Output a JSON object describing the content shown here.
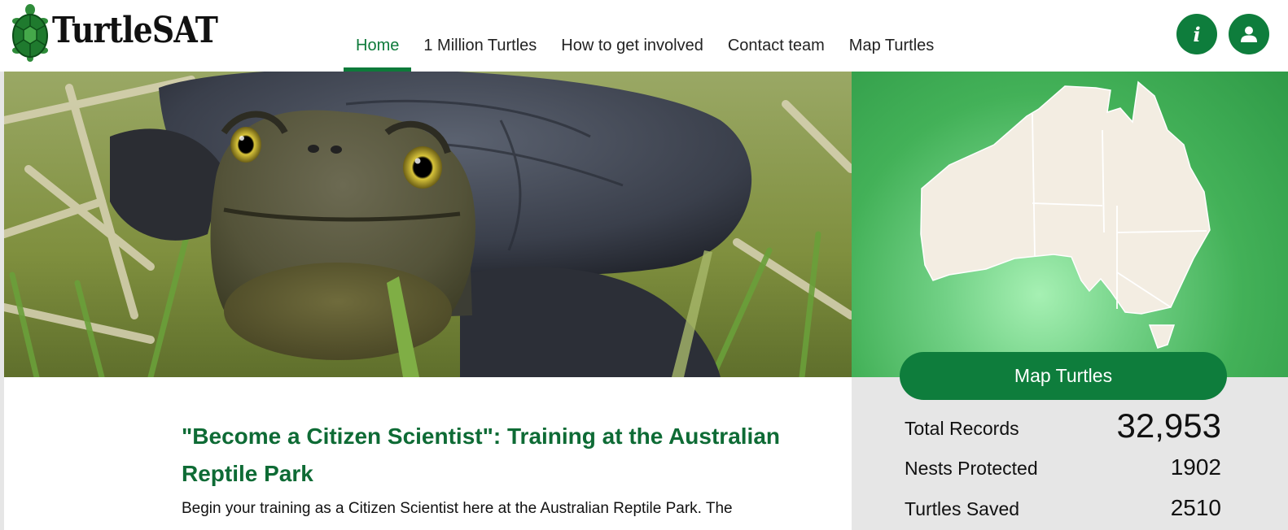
{
  "brand": {
    "name": "TurtleSAT"
  },
  "nav": {
    "items": [
      {
        "label": "Home",
        "active": true
      },
      {
        "label": "1 Million Turtles",
        "active": false
      },
      {
        "label": "How to get involved",
        "active": false
      },
      {
        "label": "Contact team",
        "active": false
      },
      {
        "label": "Map Turtles",
        "active": false
      }
    ]
  },
  "header_buttons": {
    "info_label": "i",
    "info_icon": "info-icon",
    "user_icon": "user-icon"
  },
  "sidebar": {
    "map_button_label": "Map Turtles",
    "stats": [
      {
        "label": "Total Records",
        "value": "32,953"
      },
      {
        "label": "Nests Protected",
        "value": "1902"
      },
      {
        "label": "Turtles Saved",
        "value": "2510"
      }
    ]
  },
  "article": {
    "title": "\"Become a Citizen Scientist\": Training at the Australian Reptile Park",
    "text": "Begin your training as a Citizen Scientist here at the Australian Reptile Park. The"
  },
  "colors": {
    "brand_green": "#0e7d3c",
    "title_green": "#0e6b35",
    "map_land": "#f3ede2"
  }
}
